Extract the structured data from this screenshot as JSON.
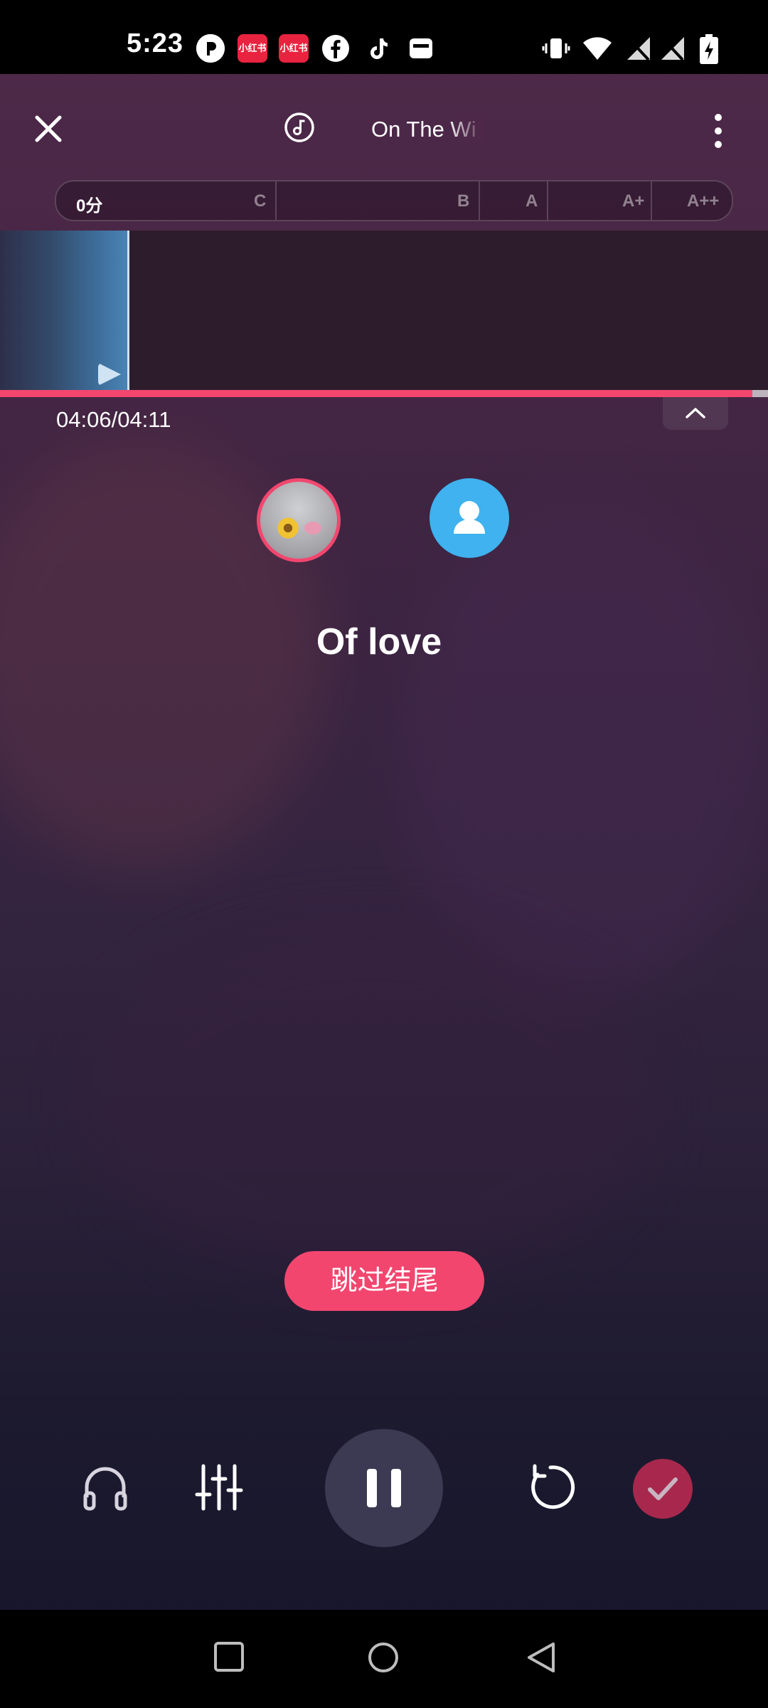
{
  "status_bar": {
    "time": "5:23",
    "app_badge_label": "小红书",
    "icons": [
      "pocket-icon",
      "xiaohongshu-icon",
      "xiaohongshu-icon",
      "facebook-icon",
      "tiktok-icon",
      "wallet-icon",
      "vibrate-icon",
      "wifi-icon",
      "no-signal-icon",
      "no-signal-icon",
      "battery-charging-icon"
    ]
  },
  "header": {
    "song_title": "On The Wi",
    "close_icon": "close-icon",
    "disc_icon": "music-disc-icon",
    "more_icon": "more-vertical-icon"
  },
  "score_bar": {
    "current_score": "0分",
    "grades": [
      "C",
      "B",
      "A",
      "A+",
      "A++"
    ]
  },
  "playback": {
    "time": "04:06/04:11",
    "progress": 0.98
  },
  "lyric": "Of love",
  "skip_button": "跳过结尾",
  "controls": {
    "icons": [
      "headphones-icon",
      "mixer-icon",
      "pause-icon",
      "restart-icon",
      "check-icon"
    ]
  },
  "colors": {
    "accent": "#f2466f",
    "avatar_blue": "#3fb2ef",
    "confirm": "#a8284d"
  }
}
